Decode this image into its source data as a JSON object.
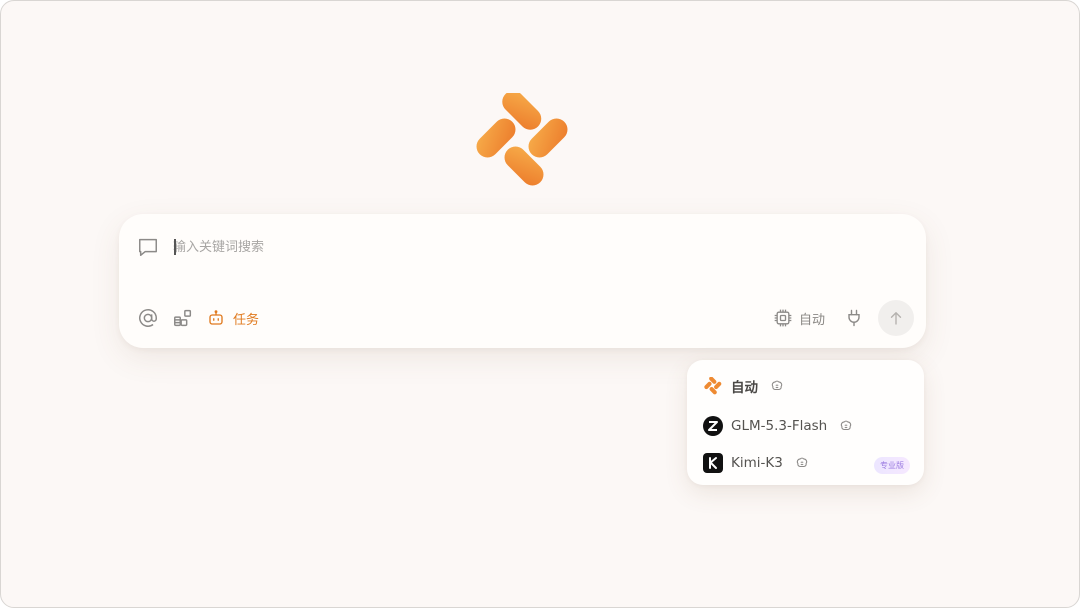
{
  "search": {
    "placeholder": "输入关键词搜索",
    "value": ""
  },
  "toolbar": {
    "task_label": "任务",
    "model_label": "自动"
  },
  "dropdown": {
    "options": [
      {
        "label": "自动",
        "icon": "app-logo-icon",
        "selected": true
      },
      {
        "label": "GLM-5.3-Flash",
        "icon": "zhipu-z-icon"
      },
      {
        "label": "Kimi-K3",
        "icon": "kimi-k-icon",
        "badge": "专业版"
      }
    ]
  },
  "colors": {
    "accent": "#e07a1f",
    "logo_light": "#f5a03c",
    "logo_dark": "#ec7d2a",
    "badge_text": "#9a7ae0"
  }
}
